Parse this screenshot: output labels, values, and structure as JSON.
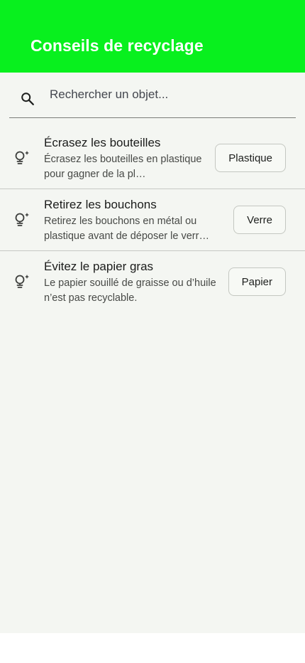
{
  "appbar": {
    "title": "Conseils de recyclage",
    "color": "#08f01e"
  },
  "search": {
    "placeholder": "Rechercher un objet...",
    "icon": "search-icon"
  },
  "tips": [
    {
      "icon": "lightbulb-sparkle-icon",
      "title": "Écrasez les bouteilles",
      "subtitle": "Écrasez les bouteilles en plastique pour gagner de la pl…",
      "tag": "Plastique"
    },
    {
      "icon": "lightbulb-sparkle-icon",
      "title": "Retirez les bouchons",
      "subtitle": "Retirez les bouchons en métal ou plastique avant de déposer le verr…",
      "tag": "Verre"
    },
    {
      "icon": "lightbulb-sparkle-icon",
      "title": "Évitez le papier gras",
      "subtitle": "Le papier souillé de graisse ou d’huile n’est pas recyclable.",
      "tag": "Papier"
    }
  ]
}
